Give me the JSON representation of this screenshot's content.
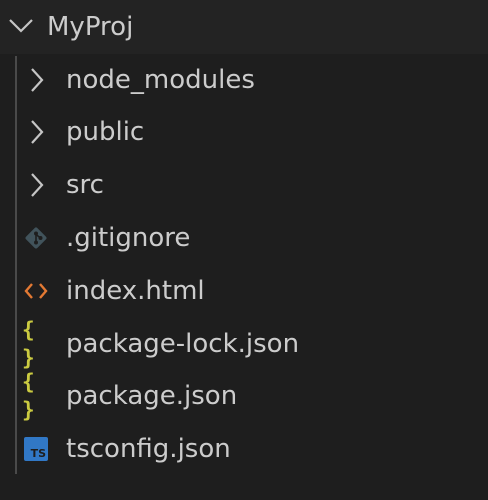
{
  "root": {
    "label": "MyProj",
    "icon": "chevron-down-icon",
    "expanded": true
  },
  "items": [
    {
      "label": "node_modules",
      "type": "folder",
      "icon": "chevron-right-icon"
    },
    {
      "label": "public",
      "type": "folder",
      "icon": "chevron-right-icon"
    },
    {
      "label": "src",
      "type": "folder",
      "icon": "chevron-right-icon"
    },
    {
      "label": ".gitignore",
      "type": "file",
      "icon": "git-icon",
      "icon_color": "#41535b"
    },
    {
      "label": "index.html",
      "type": "file",
      "icon": "html-icon",
      "icon_color": "#e37933"
    },
    {
      "label": "package-lock.json",
      "type": "file",
      "icon": "json-icon",
      "icon_color": "#cbcb41",
      "icon_text": "{ }"
    },
    {
      "label": "package.json",
      "type": "file",
      "icon": "json-icon",
      "icon_color": "#cbcb41",
      "icon_text": "{ }"
    },
    {
      "label": "tsconfig.json",
      "type": "file",
      "icon": "typescript-icon",
      "icon_color": "#3178c6",
      "icon_text": "TS"
    }
  ],
  "colors": {
    "background": "#1e1e1e",
    "text": "#cccccc",
    "chevron": "#c5c5c5",
    "indent_guide": "#4a4a4a"
  }
}
